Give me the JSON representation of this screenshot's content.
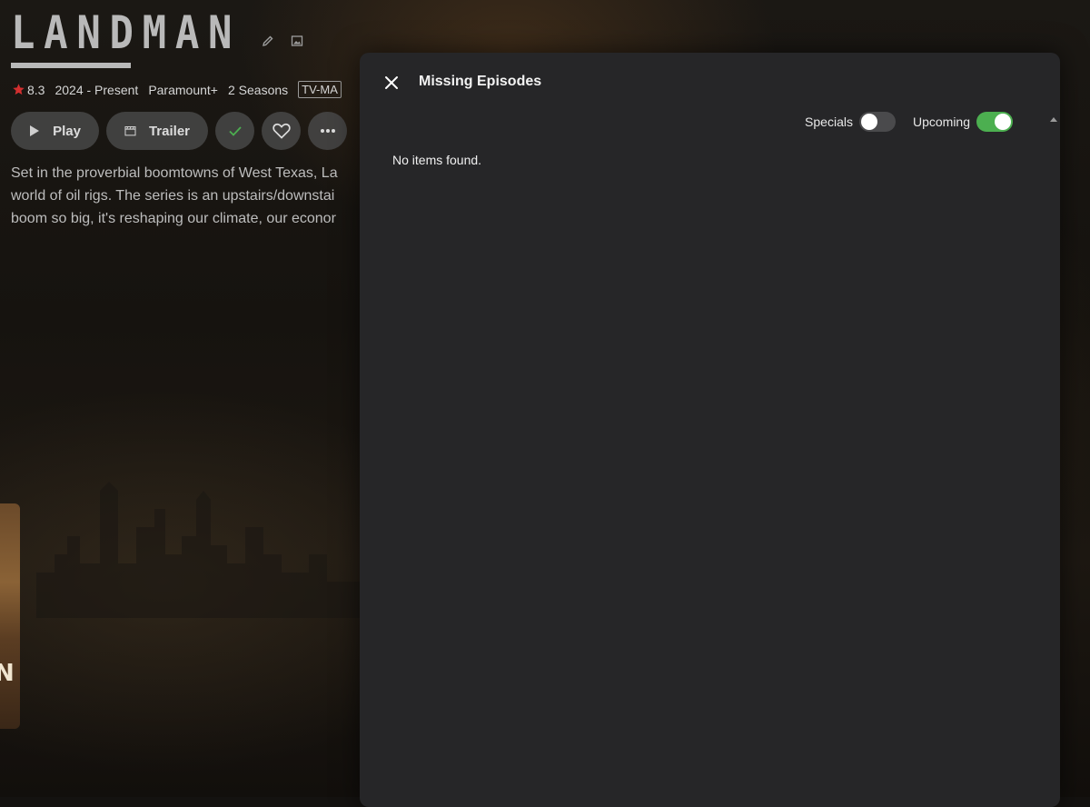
{
  "series": {
    "logo_text": "LANDMAN",
    "rating": "8.3",
    "years": "2024 - Present",
    "network": "Paramount+",
    "seasons": "2 Seasons",
    "content_rating": "TV-MA",
    "overview_lines": [
      "Set in the proverbial boomtowns of West Texas, La",
      "world of oil rigs. The series is an upstairs/downstai",
      "boom so big, it's reshaping our climate, our econor"
    ]
  },
  "actions": {
    "play_label": "Play",
    "trailer_label": "Trailer"
  },
  "poster": {
    "visible_letter": "N"
  },
  "dialog": {
    "title": "Missing Episodes",
    "specials_label": "Specials",
    "specials_enabled": false,
    "upcoming_label": "Upcoming",
    "upcoming_enabled": true,
    "empty_message": "No items found."
  },
  "colors": {
    "accent_green": "#4caf50",
    "star": "#d32f2f",
    "dialog_bg": "#262628",
    "watched_check": "#4caf50"
  },
  "icons": {
    "edit": "pencil-icon",
    "image": "image-icon",
    "rating": "star-icon",
    "play": "play-icon",
    "trailer": "clapperboard-icon",
    "watched": "check-icon",
    "favorite": "heart-icon",
    "more": "more-icon",
    "close": "close-icon",
    "scroll": "scroll-up-icon"
  }
}
